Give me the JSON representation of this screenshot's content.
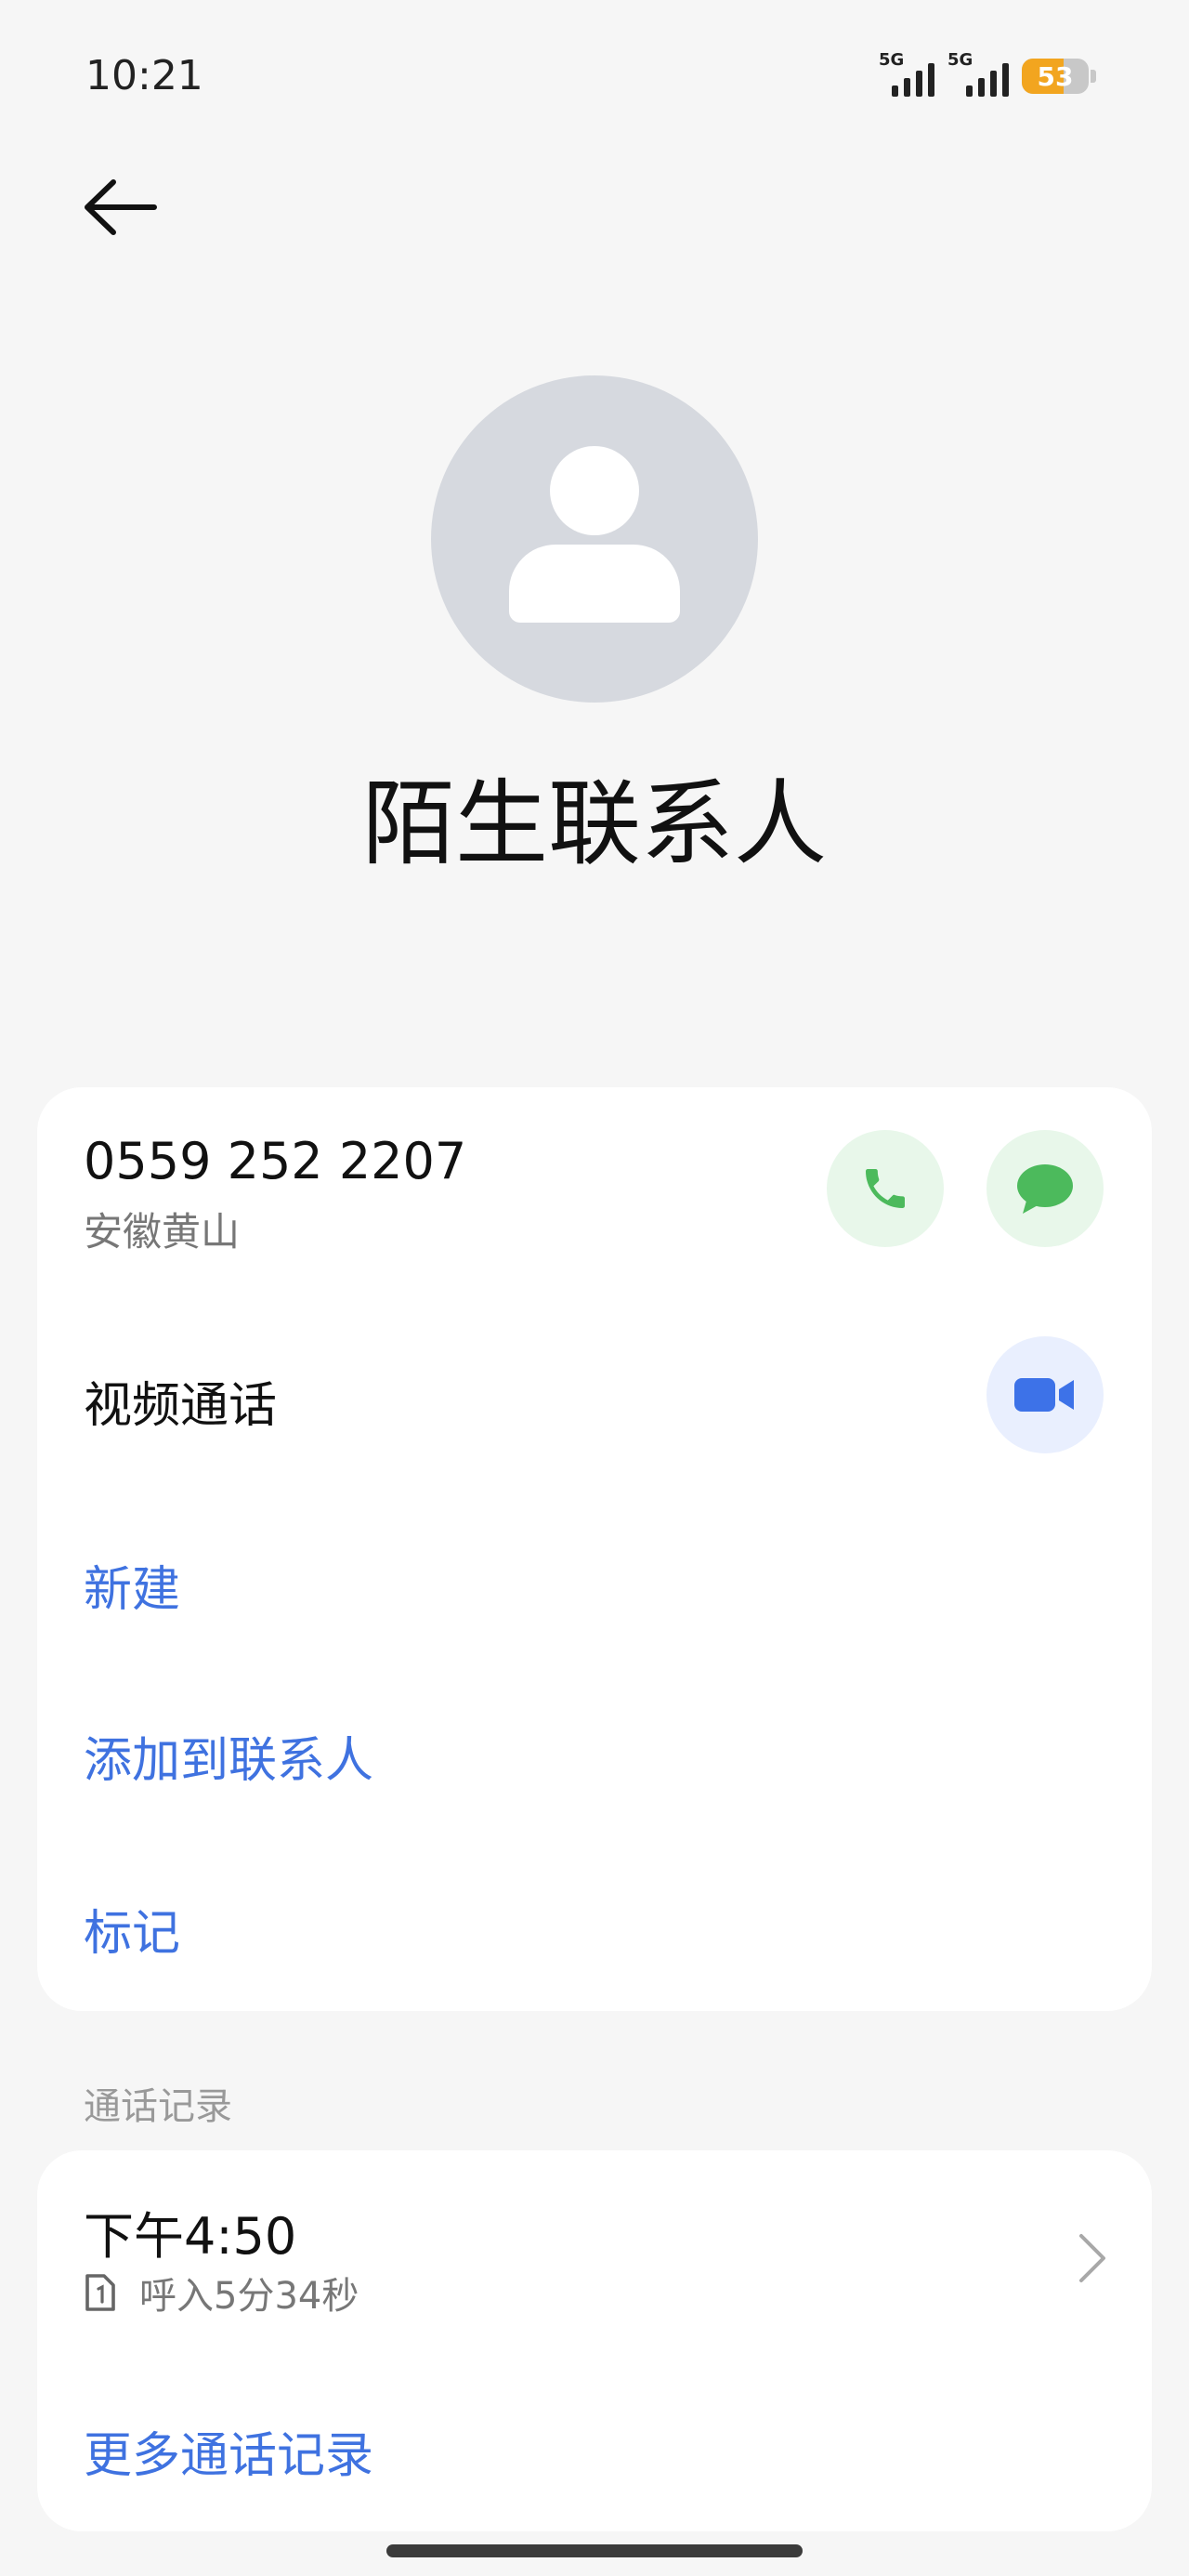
{
  "status_bar": {
    "time": "10:21",
    "signal1_label": "5G",
    "signal2_label": "5G",
    "battery": "53",
    "battery_color": "#f2a51f"
  },
  "header": {
    "back_icon": "arrow-left-icon"
  },
  "contact": {
    "avatar_icon": "person-icon",
    "name": "陌生联系人",
    "phone": "0559 252 2207",
    "location": "安徽黄山"
  },
  "actions": {
    "call_icon": "phone-icon",
    "message_icon": "message-icon",
    "video_icon": "video-camera-icon",
    "video_call": "视频通话",
    "new": "新建",
    "add_to_contacts": "添加到联系人",
    "mark": "标记"
  },
  "call_log": {
    "section_title": "通话记录",
    "entries": [
      {
        "time": "下午4:50",
        "sim_icon": "sim1-icon",
        "detail": "呼入5分34秒"
      }
    ],
    "more": "更多通话记录"
  },
  "colors": {
    "accent_blue": "#3f72e0",
    "call_green": "#4cba5c",
    "video_blue": "#3d72e8"
  }
}
